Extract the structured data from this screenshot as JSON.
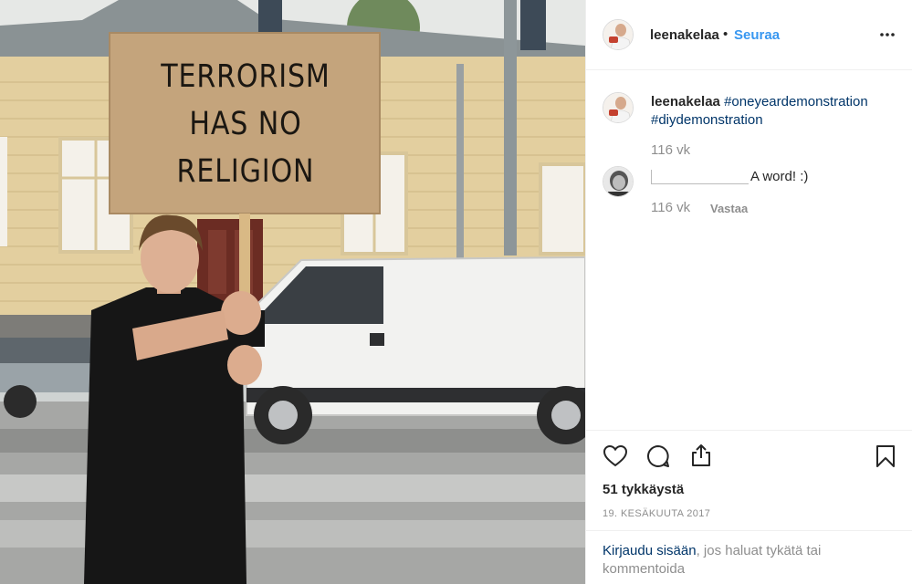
{
  "post": {
    "username": "leenakelaa",
    "separator": "•",
    "follow_label": "Seuraa",
    "photo_sign_lines": [
      "TERRORISM",
      "HAS NO",
      "RELIGION"
    ]
  },
  "comments": [
    {
      "username": "leenakelaa",
      "hashtags": [
        "#oneyeardemonstration",
        "#diydemonstration"
      ],
      "time": "116 vk"
    },
    {
      "text": "A word! :)",
      "time": "116 vk",
      "reply_label": "Vastaa"
    }
  ],
  "actions": {
    "icons": [
      "heart-icon",
      "comment-icon",
      "share-icon",
      "bookmark-icon"
    ],
    "likes": "51 tykkäystä",
    "date": "19. KESÄKUUTA 2017"
  },
  "login": {
    "link_text": "Kirjaudu sisään",
    "rest_text": ", jos haluat tykätä tai kommentoida"
  },
  "colors": {
    "link_blue": "#3897f0",
    "hashtag_blue": "#003569",
    "muted": "#8e8e8e",
    "text": "#262626"
  }
}
